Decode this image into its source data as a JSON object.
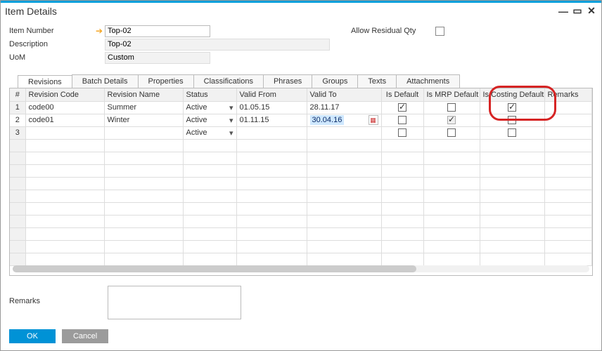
{
  "window": {
    "title": "Item Details"
  },
  "form": {
    "item_number_label": "Item Number",
    "item_number_value": "Top-02",
    "description_label": "Description",
    "description_value": "Top-02",
    "uom_label": "UoM",
    "uom_value": "Custom",
    "allow_residual_label": "Allow Residual Qty",
    "allow_residual_checked": false
  },
  "tabs": {
    "revisions": "Revisions",
    "batch_details": "Batch Details",
    "properties": "Properties",
    "classifications": "Classifications",
    "phrases": "Phrases",
    "groups": "Groups",
    "texts": "Texts",
    "attachments": "Attachments"
  },
  "grid": {
    "headers": {
      "num": "#",
      "rev_code": "Revision Code",
      "rev_name": "Revision Name",
      "status": "Status",
      "valid_from": "Valid From",
      "valid_to": "Valid To",
      "is_default": "Is Default",
      "is_mrp_default": "Is MRP Default",
      "is_costing_default": "Is Costing Default",
      "remarks": "Remarks"
    },
    "rows": [
      {
        "num": "1",
        "code": "code00",
        "name": "Summer",
        "status": "Active",
        "valid_from": "01.05.15",
        "valid_to": "28.11.17",
        "is_default": true,
        "is_mrp_default": false,
        "is_costing_default": true
      },
      {
        "num": "2",
        "code": "code01",
        "name": "Winter",
        "status": "Active",
        "valid_from": "01.11.15",
        "valid_to": "30.04.16",
        "is_default": false,
        "is_mrp_default": true,
        "is_mrp_default_disabled": true,
        "is_costing_default": false
      },
      {
        "num": "3",
        "code": "",
        "name": "",
        "status": "Active",
        "valid_from": "",
        "valid_to": "",
        "is_default": false,
        "is_mrp_default": false,
        "is_costing_default": false
      }
    ]
  },
  "remarks": {
    "label": "Remarks",
    "value": ""
  },
  "buttons": {
    "ok": "OK",
    "cancel": "Cancel"
  }
}
